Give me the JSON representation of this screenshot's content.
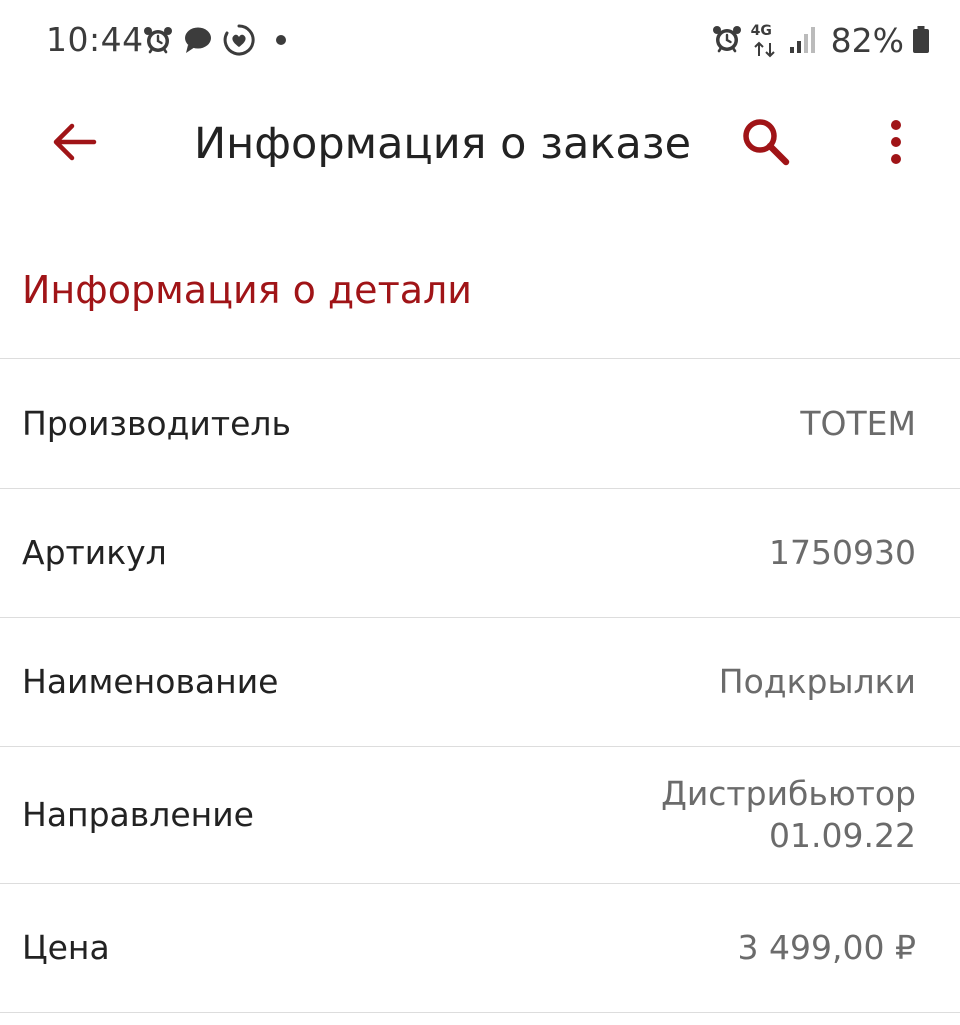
{
  "status_bar": {
    "time": "10:44",
    "battery": "82%",
    "network": "4G",
    "left_icons": [
      "alarm-icon",
      "chat-bubble-icon",
      "health-heart-icon",
      "dot-icon"
    ],
    "right_icons": [
      "alarm-icon",
      "network-4g-icon",
      "signal-icon",
      "battery-icon"
    ]
  },
  "app_bar": {
    "title": "Информация о заказе",
    "back_icon": "arrow-left-icon",
    "search_icon": "search-icon",
    "more_icon": "more-vert-icon"
  },
  "section": {
    "title": "Информация о детали"
  },
  "details": [
    {
      "label": "Производитель",
      "value": "TOTEM"
    },
    {
      "label": "Артикул",
      "value": "1750930"
    },
    {
      "label": "Наименование",
      "value": "Подкрылки"
    },
    {
      "label": "Направление",
      "value_lines": [
        "Дистрибьютор",
        "01.09.22"
      ]
    },
    {
      "label": "Цена",
      "value": "3 499,00 ₽"
    }
  ],
  "colors": {
    "accent": "#a01417",
    "text_primary": "#222222",
    "text_secondary": "#6b6b6b",
    "divider": "#dddddd",
    "status_text": "#3c3c3c"
  }
}
